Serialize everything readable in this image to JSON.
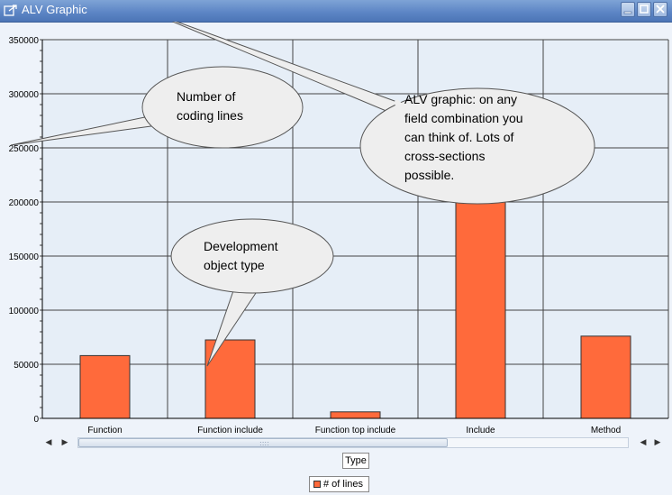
{
  "window": {
    "title": "ALV Graphic",
    "title_icon": "export-icon",
    "controls": [
      "minimize-icon",
      "maximize-icon",
      "close-icon"
    ]
  },
  "colors": {
    "bar": "#ff6a3b",
    "bar_stroke": "#333333",
    "plot_background": "#e6eef7",
    "grid": "#444444",
    "titlebar": "#5b84c4",
    "callout_fill": "#eeeeee",
    "callout_stroke": "#555555"
  },
  "chart_data": {
    "type": "bar",
    "categories": [
      "Function",
      "Function include",
      "Function top include",
      "Include",
      "Method"
    ],
    "series": [
      {
        "name": "# of lines",
        "values": [
          58000,
          72500,
          6000,
          230000,
          76000
        ]
      }
    ],
    "xlabel": "Type",
    "ylabel": "",
    "ylim": [
      0,
      350000
    ],
    "yticks": [
      "0",
      "50000",
      "100000",
      "150000",
      "200000",
      "250000",
      "300000",
      "350000"
    ],
    "grid": true,
    "legend": "bottom-center"
  },
  "annotations": [
    {
      "name": "callout-coding-lines",
      "lines": [
        "Number of",
        "coding lines"
      ]
    },
    {
      "name": "callout-object-type",
      "lines": [
        "Development",
        "object type"
      ]
    },
    {
      "name": "callout-alv-graphic",
      "lines": [
        "ALV graphic: on any",
        "field combination you",
        "can think of. Lots of",
        "cross-sections",
        "possible."
      ]
    }
  ],
  "scrollbar": {
    "left_arrows": [
      "◀",
      "▶"
    ],
    "right_arrows": [
      "◀",
      "▶"
    ],
    "grip": "::::"
  }
}
